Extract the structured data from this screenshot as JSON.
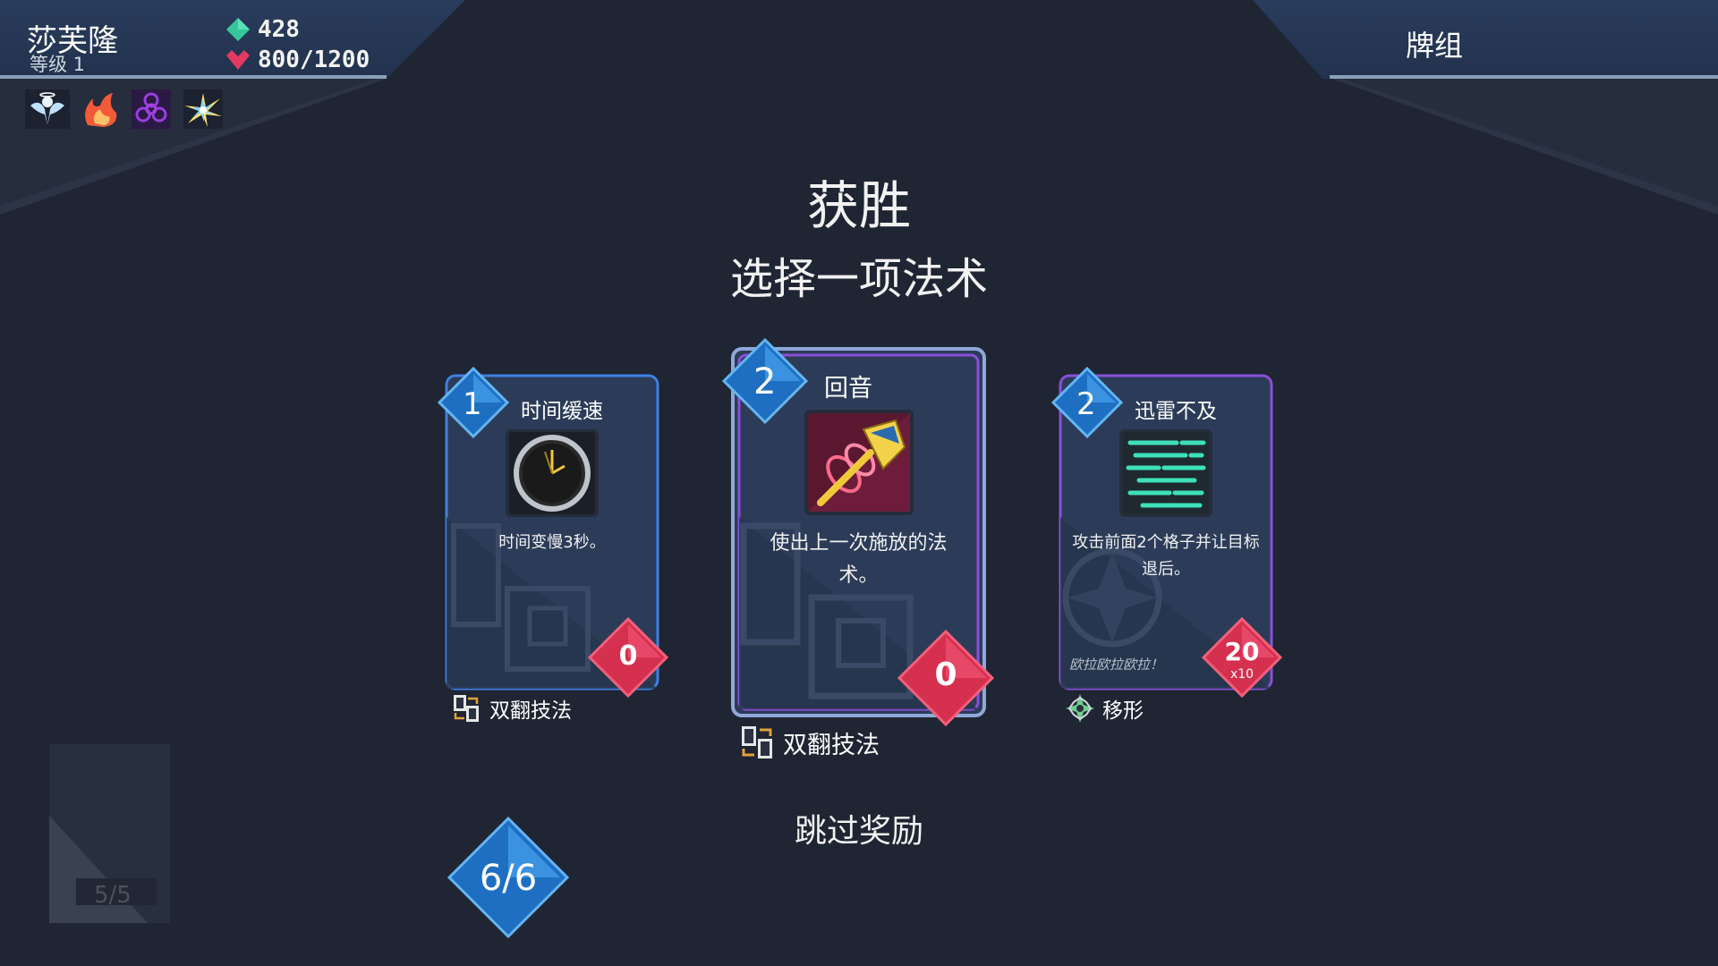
{
  "player": {
    "name": "莎芙隆",
    "level": "等级 1"
  },
  "stats": {
    "gold": "428",
    "hp": "800/1200"
  },
  "header": {
    "deck_label": "牌组"
  },
  "relics": [
    "angel-icon",
    "flame-icon",
    "biohazard-icon",
    "prism-burst-icon"
  ],
  "titles": {
    "victory": "获胜",
    "choose": "选择一项法术"
  },
  "cards": [
    {
      "name": "时间缓速",
      "cost": "1",
      "description": "时间变慢3秒。",
      "damage": "0",
      "footer": "双翻技法",
      "art": "clock-icon",
      "rarity_color": "#3f7fe0"
    },
    {
      "name": "回音",
      "cost": "2",
      "description": "使出上一次施放的法术。",
      "damage": "0",
      "footer": "双翻技法",
      "art": "echo-hammer-icon",
      "rarity_color": "#8a4fd8"
    },
    {
      "name": "迅雷不及",
      "cost": "2",
      "description": "攻击前面2个格子并让目标退后。",
      "damage": "20",
      "damage_multiplier": "x10",
      "flavor": "欧拉欧拉欧拉！",
      "footer": "移形",
      "art": "speed-lines-icon",
      "rarity_color": "#8a4fd8"
    }
  ],
  "skip_label": "跳过奖励",
  "pick_counter": "6/6",
  "ghost_counter": "5/5",
  "colors": {
    "accent_blue": "#2f8ad8",
    "damage_red": "#e0375a",
    "gold_green": "#35c79a",
    "hp_pink": "#e23a62"
  }
}
